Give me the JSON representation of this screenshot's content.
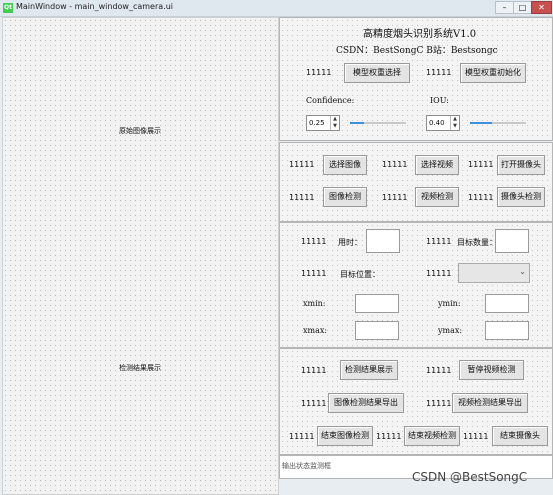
{
  "window": {
    "title": "MainWindow - main_window_camera.ui",
    "icon_text": "Qt"
  },
  "left": {
    "original_label": "原始图像展示",
    "result_label": "检测结果展示"
  },
  "header": {
    "title": "高精度烟头识别系统V1.0",
    "subtitle": "CSDN：BestSongC   B站：Bestsongc"
  },
  "model": {
    "label_1": "11111",
    "select_weights": "模型权重选择",
    "label_2": "11111",
    "init_weights": "模型权重初始化",
    "confidence_label": "Confidence:",
    "iou_label": "IOU:",
    "confidence_value": "0.25",
    "iou_value": "0.40",
    "confidence_slider": 0.25,
    "iou_slider": 0.4
  },
  "source": {
    "row1": [
      {
        "label": "11111",
        "button": "选择图像"
      },
      {
        "label": "11111",
        "button": "选择视频"
      },
      {
        "label": "11111",
        "button": "打开摄像头"
      }
    ],
    "row2": [
      {
        "label": "11111",
        "button": "图像检测"
      },
      {
        "label": "11111",
        "button": "视频检测"
      },
      {
        "label": "11111",
        "button": "摄像头检测"
      }
    ]
  },
  "info": {
    "label_1": "11111",
    "time_label": "用时：",
    "label_2": "11111",
    "count_label": "目标数量：",
    "label_3": "11111",
    "position_label": "目标位置：",
    "label_4": "11111",
    "xmin_label": "xmin:",
    "ymin_label": "ymin:",
    "xmax_label": "xmax:",
    "ymax_label": "ymax:"
  },
  "actions": {
    "row1": [
      {
        "label": "11111",
        "button": "检测结果展示"
      },
      {
        "label": "11111",
        "button": "暂停视频检测"
      }
    ],
    "row2": [
      {
        "label": "11111",
        "button": "图像检测结果导出"
      },
      {
        "label": "11111",
        "button": "视频检测结果导出"
      }
    ],
    "row3": [
      {
        "label": "11111",
        "button": "结束图像检测"
      },
      {
        "label": "11111",
        "button": "结束视频检测"
      },
      {
        "label": "11111",
        "button": "结束摄像头"
      }
    ]
  },
  "status": {
    "placeholder": "输出状态监测框"
  },
  "watermark": "CSDN @BestSongC"
}
